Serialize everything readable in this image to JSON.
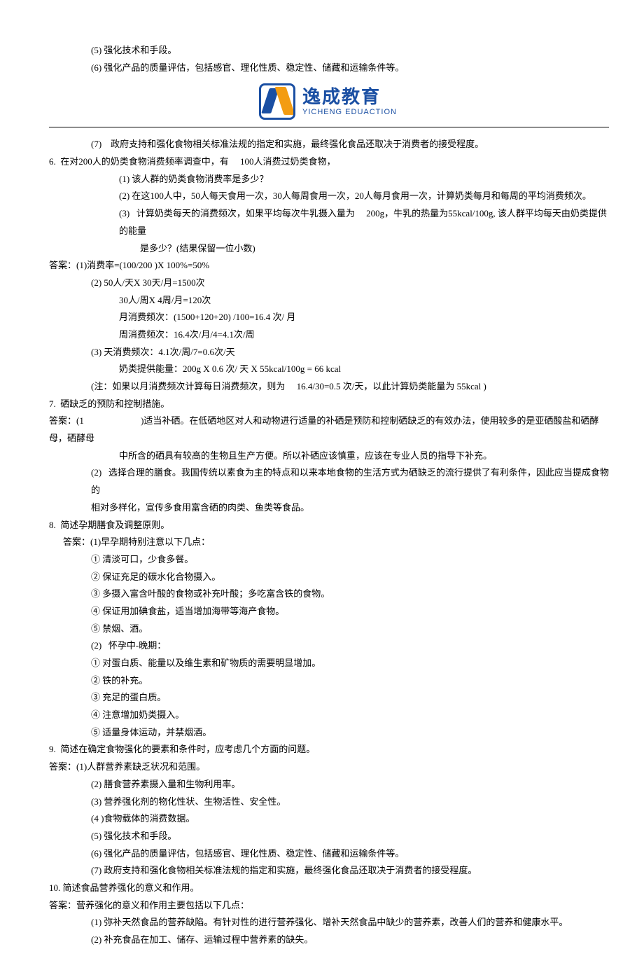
{
  "logo": {
    "cn": "逸成教育",
    "en": "YICHENG EDUACTION"
  },
  "l1": "(5) 强化技术和手段。",
  "l2": "(6) 强化产品的质量评估，包括感官、理化性质、稳定性、储藏和运输条件等。",
  "l3": "(7)    政府支持和强化食物相关标准法规的指定和实施，最终强化食品还取决于消费者的接受程度。",
  "q6": "6.  在对200人的奶类食物消费频率调查中，有     100人消费过奶类食物，",
  "q6_1": "(1) 该人群的奶类食物消费率是多少？",
  "q6_2": "(2) 在这100人中，50人每天食用一次，30人每周食用一次，20人每月食用一次，计算奶类每月和每周的平均消费频次。",
  "q6_3a": "(3)   计算奶类每天的消费频次，如果平均每次牛乳摄入量为     200g，牛乳的热量为55kcal/100g, 该人群平均每天由奶类提供的能量",
  "q6_3b": "是多少？(结果保留一位小数)",
  "a6_1": "答案：(1)消费率=(100/200 )X 100%=50%",
  "a6_2a": "(2) 50人/天X 30天/月=1500次",
  "a6_2b": "30人/周X 4周/月=120次",
  "a6_2c": "月消费频次：(1500+120+20) /100=16.4 次/ 月",
  "a6_2d": "周消费频次：16.4次/月/4=4.1次/周",
  "a6_3a": "(3) 天消费频次：4.1次/周/7=0.6次/天",
  "a6_3b": "奶类提供能量：200g X 0.6 次/ 天 X 55kcal/100g = 66 kcal",
  "a6_note": "(注：如果以月消费频次计算每日消费频次，则为     16.4/30=0.5 次/天，以此计算奶类能量为 55kcal )",
  "q7": "7.  硒缺乏的预防和控制措施。",
  "a7_1a": "答案：(1                         )适当补硒。在低硒地区对人和动物进行适量的补硒是预防和控制硒缺乏的有效办法，使用较多的是亚硒酸盐和硒酵母，硒酵母",
  "a7_1b": "中所含的硒具有较高的生物且生产方便。所以补硒应该慎重，应该在专业人员的指导下补充。",
  "a7_2a": "(2)   选择合理的膳食。我国传统以素食为主的特点和以来本地食物的生活方式为硒缺乏的流行提供了有利条件，因此应当提成食物的",
  "a7_2b": "相对多样化，宣传多食用富含硒的肉类、鱼类等食品。",
  "q8": "8.  简述孕期膳食及调整原则。",
  "a8_head": "答案：(1)早孕期特别注意以下几点：",
  "a8_1": "① 清淡可口，少食多餐。",
  "a8_2": "② 保证充足的碳水化合物摄入。",
  "a8_3": "③ 多摄入富含叶酸的食物或补充叶酸；多吃富含铁的食物。",
  "a8_4": "④ 保证用加碘食盐，适当增加海带等海产食物。",
  "a8_5": "⑤ 禁烟、酒。",
  "a8_mid": "(2)   怀孕中-晚期：",
  "a8_m1": "① 对蛋白质、能量以及维生素和矿物质的需要明显增加。",
  "a8_m2": "② 铁的补充。",
  "a8_m3": "③ 充足的蛋白质。",
  "a8_m4": "④ 注意增加奶类摄入。",
  "a8_m5": "⑤ 适量身体运动，并禁烟酒。",
  "q9": "9.  简述在确定食物强化的要素和条件时，应考虑几个方面的问题。",
  "a9_1": "答案：(1)人群营养素缺乏状况和范围。",
  "a9_2": "(2) 膳食营养素摄入量和生物利用率。",
  "a9_3": "(3) 营养强化剂的物化性状、生物活性、安全性。",
  "a9_4": "(4 )食物载体的消费数据。",
  "a9_5": "(5) 强化技术和手段。",
  "a9_6": "(6) 强化产品的质量评估，包括感官、理化性质、稳定性、储藏和运输条件等。",
  "a9_7": "(7) 政府支持和强化食物相关标准法规的指定和实施，最终强化食品还取决于消费者的接受程度。",
  "q10": "10. 简述食品营养强化的意义和作用。",
  "a10_head": "答案：营养强化的意义和作用主要包括以下几点：",
  "a10_1": "(1) 弥补天然食品的营养缺陷。有针对性的进行营养强化、增补天然食品中缺少的营养素，改善人们的营养和健康水平。",
  "a10_2": "(2) 补充食品在加工、储存、运输过程中营养素的缺失。"
}
